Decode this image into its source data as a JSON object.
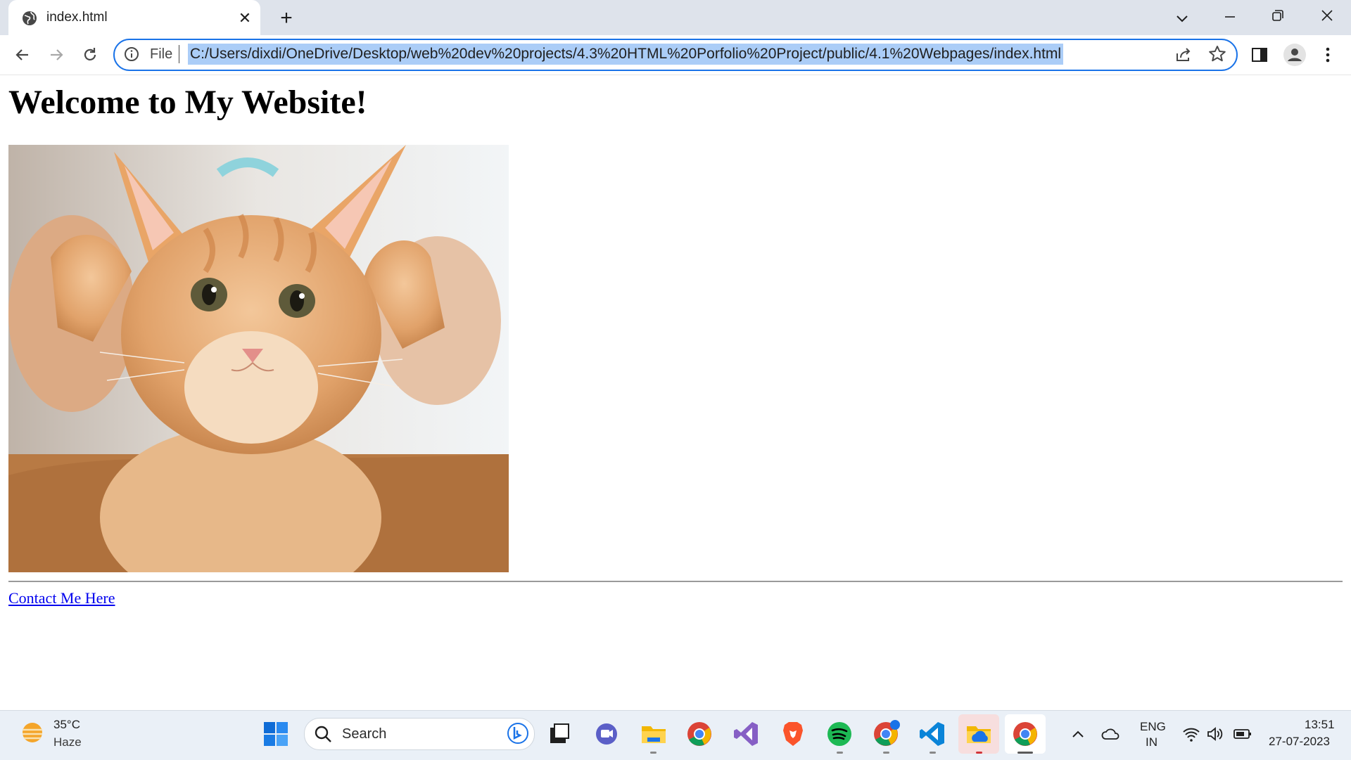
{
  "browser": {
    "tab": {
      "title": "index.html",
      "close_glyph": "✕"
    },
    "new_tab_glyph": "+",
    "address": {
      "scheme_label": "File",
      "url": "C:/Users/dixdi/OneDrive/Desktop/web%20dev%20projects/4.3%20HTML%20Porfolio%20Project/public/4.1%20Webpages/index.html"
    },
    "icons": [
      "globe-icon",
      "tab-search-icon",
      "minimize-icon",
      "restore-icon",
      "close-window-icon",
      "back-icon",
      "forward-icon",
      "reload-icon",
      "info-icon",
      "share-icon",
      "bookmark-star-icon",
      "side-panel-icon",
      "profile-icon",
      "menu-icon"
    ]
  },
  "page": {
    "heading": "Welcome to My Website!",
    "image": {
      "subject": "orange tabby kitten held in hands"
    },
    "link": "Contact Me Here"
  },
  "taskbar": {
    "weather": {
      "temp": "35°C",
      "condition": "Haze"
    },
    "search_label": "Search",
    "apps": [
      "windows-start-icon",
      "task-view-icon",
      "teams-chat-icon",
      "file-explorer-icon",
      "chrome-icon",
      "visual-studio-icon",
      "brave-icon",
      "spotify-icon",
      "chrome-profile-icon",
      "vscode-icon",
      "onedrive-folder-icon",
      "chrome-active-icon"
    ],
    "tray": {
      "lang_line1": "ENG",
      "lang_line2": "IN"
    },
    "clock": {
      "time": "13:51",
      "date": "27-07-2023"
    }
  },
  "colors": {
    "accent": "#1a73e8",
    "link": "#0000ee",
    "url_highlight": "#abcdf7",
    "tabstrip": "#dee3eb"
  }
}
